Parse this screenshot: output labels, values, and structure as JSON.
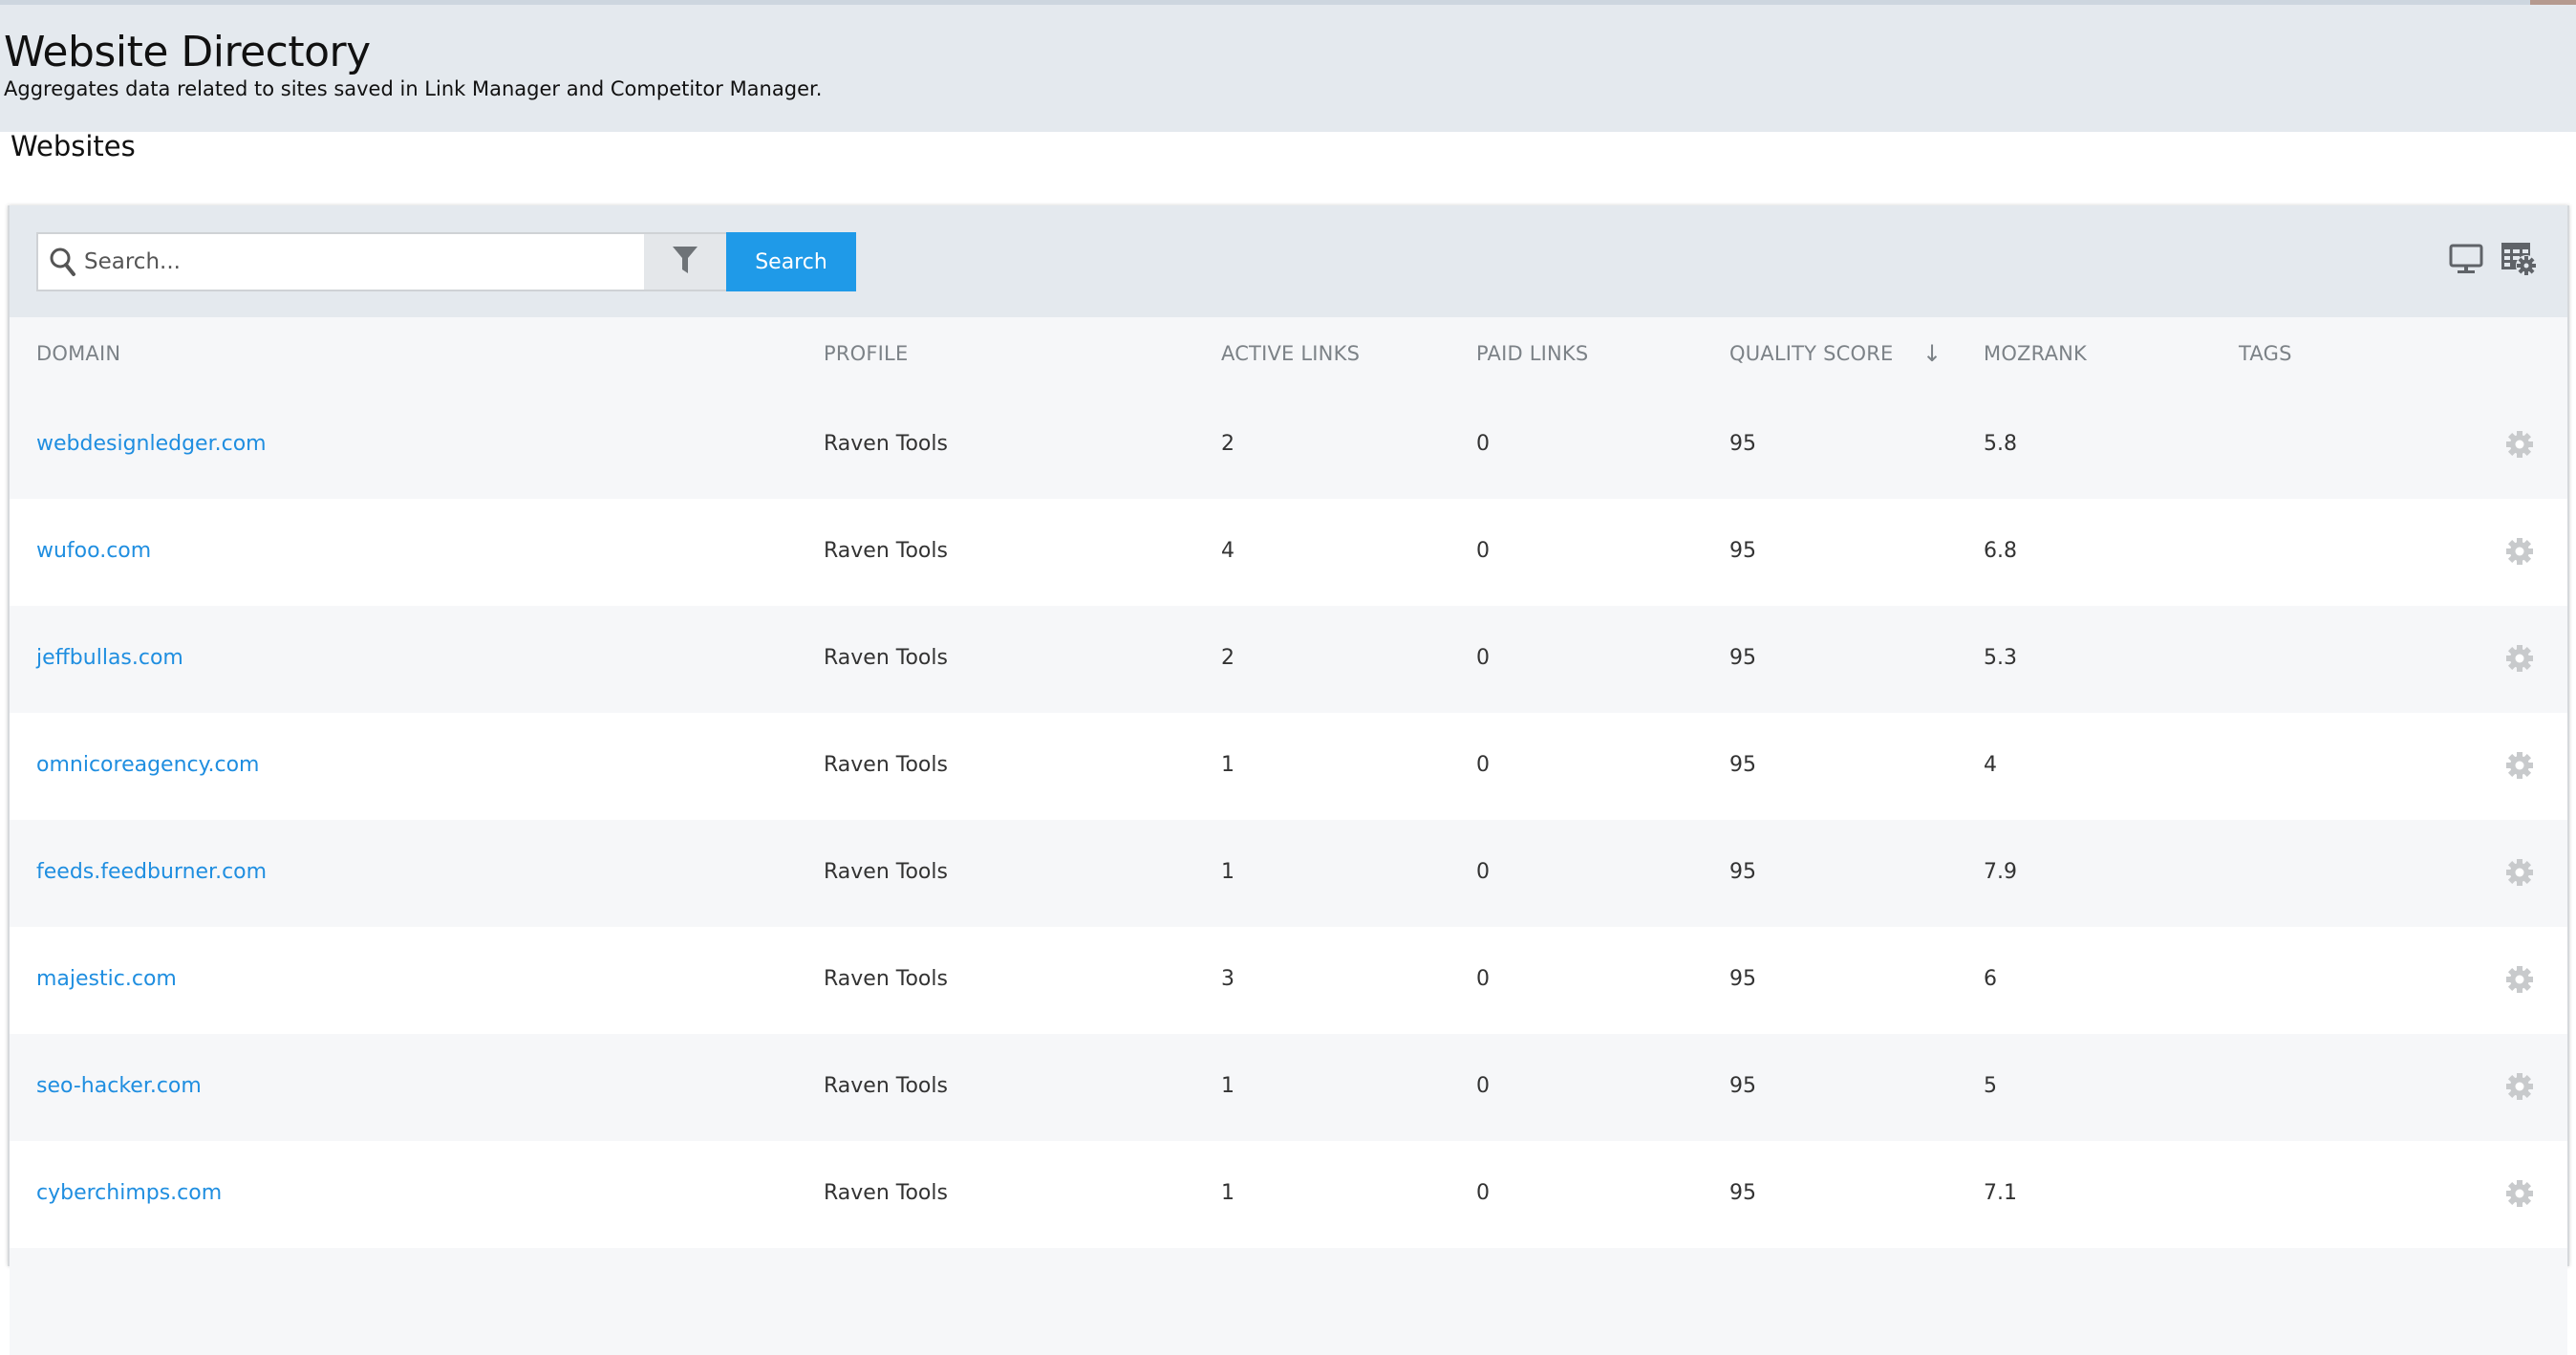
{
  "header": {
    "title": "Website Directory",
    "subtitle": "Aggregates data related to sites saved in Link Manager and Competitor Manager."
  },
  "section": {
    "title": "Websites"
  },
  "toolbar": {
    "search_placeholder": "Search...",
    "search_value": "",
    "search_button_label": "Search",
    "icons": [
      "search-icon",
      "filter-icon",
      "monitor-icon",
      "table-settings-icon"
    ]
  },
  "colors": {
    "accent": "#1f9ae8",
    "link": "#1f8ee0",
    "header_bg": "#e4e9ee",
    "row_alt_bg": "#f6f7f9"
  },
  "table": {
    "columns": [
      "DOMAIN",
      "PROFILE",
      "ACTIVE LINKS",
      "PAID LINKS",
      "QUALITY SCORE",
      "MOZRANK",
      "TAGS"
    ],
    "sort": {
      "column": "QUALITY SCORE",
      "direction": "descending",
      "indicator": "↓"
    },
    "rows": [
      {
        "domain": "webdesignledger.com",
        "profile": "Raven Tools",
        "active_links": "2",
        "paid_links": "0",
        "quality_score": "95",
        "mozrank": "5.8",
        "tags": ""
      },
      {
        "domain": "wufoo.com",
        "profile": "Raven Tools",
        "active_links": "4",
        "paid_links": "0",
        "quality_score": "95",
        "mozrank": "6.8",
        "tags": ""
      },
      {
        "domain": "jeffbullas.com",
        "profile": "Raven Tools",
        "active_links": "2",
        "paid_links": "0",
        "quality_score": "95",
        "mozrank": "5.3",
        "tags": ""
      },
      {
        "domain": "omnicoreagency.com",
        "profile": "Raven Tools",
        "active_links": "1",
        "paid_links": "0",
        "quality_score": "95",
        "mozrank": "4",
        "tags": ""
      },
      {
        "domain": "feeds.feedburner.com",
        "profile": "Raven Tools",
        "active_links": "1",
        "paid_links": "0",
        "quality_score": "95",
        "mozrank": "7.9",
        "tags": ""
      },
      {
        "domain": "majestic.com",
        "profile": "Raven Tools",
        "active_links": "3",
        "paid_links": "0",
        "quality_score": "95",
        "mozrank": "6",
        "tags": ""
      },
      {
        "domain": "seo-hacker.com",
        "profile": "Raven Tools",
        "active_links": "1",
        "paid_links": "0",
        "quality_score": "95",
        "mozrank": "5",
        "tags": ""
      },
      {
        "domain": "cyberchimps.com",
        "profile": "Raven Tools",
        "active_links": "1",
        "paid_links": "0",
        "quality_score": "95",
        "mozrank": "7.1",
        "tags": ""
      }
    ]
  }
}
